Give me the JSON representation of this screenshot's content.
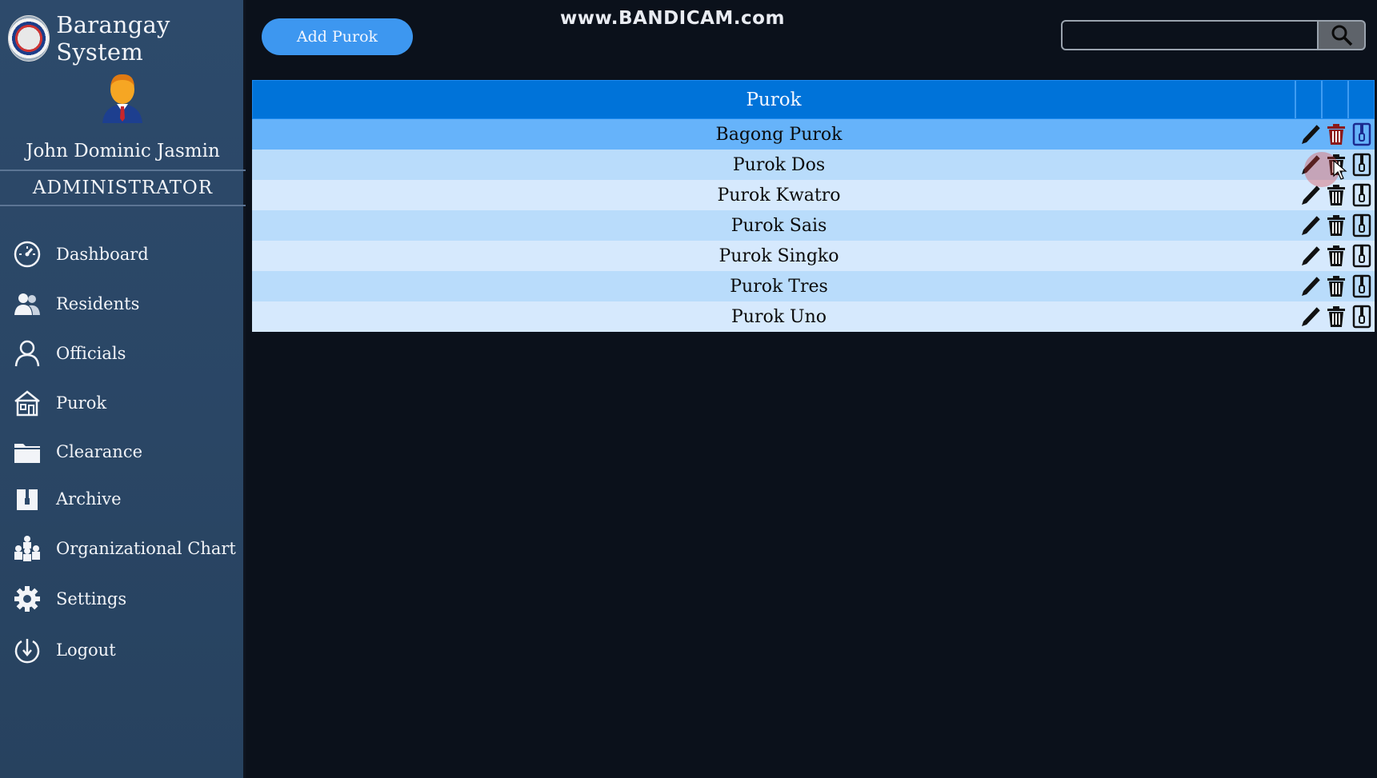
{
  "app": {
    "title": "Barangay System",
    "watermark": "www.BANDICAM.com"
  },
  "user": {
    "name": "John Dominic Jasmin",
    "role": "ADMINISTRATOR"
  },
  "sidebar": {
    "items": [
      {
        "label": "Dashboard",
        "icon": "dashboard-icon"
      },
      {
        "label": "Residents",
        "icon": "residents-icon"
      },
      {
        "label": "Officials",
        "icon": "user-icon"
      },
      {
        "label": "Purok",
        "icon": "house-icon"
      },
      {
        "label": "Clearance",
        "icon": "folder-icon"
      },
      {
        "label": "Archive",
        "icon": "archive-icon"
      },
      {
        "label": "Organizational Chart",
        "icon": "org-chart-icon"
      },
      {
        "label": "Settings",
        "icon": "gear-icon"
      },
      {
        "label": "Logout",
        "icon": "logout-icon"
      }
    ]
  },
  "toolbar": {
    "add_label": "Add Purok",
    "search_placeholder": "",
    "search_value": ""
  },
  "table": {
    "header": "Purok",
    "rows": [
      "Bagong Purok",
      "Purok Dos",
      "Purok Kwatro",
      "Purok Sais",
      "Purok Singko",
      "Purok Tres",
      "Purok Uno"
    ],
    "row_colors": [
      "#66b3fa",
      "#b9dcfb",
      "#d6e9fd",
      "#b9dcfb",
      "#d6e9fd",
      "#b9dcfb",
      "#d6e9fd"
    ],
    "hovered_row": 1
  },
  "colors": {
    "sidebar": "#2d4a6b",
    "accent": "#0073d9",
    "button": "#3d97f0",
    "background": "#0b111b"
  }
}
